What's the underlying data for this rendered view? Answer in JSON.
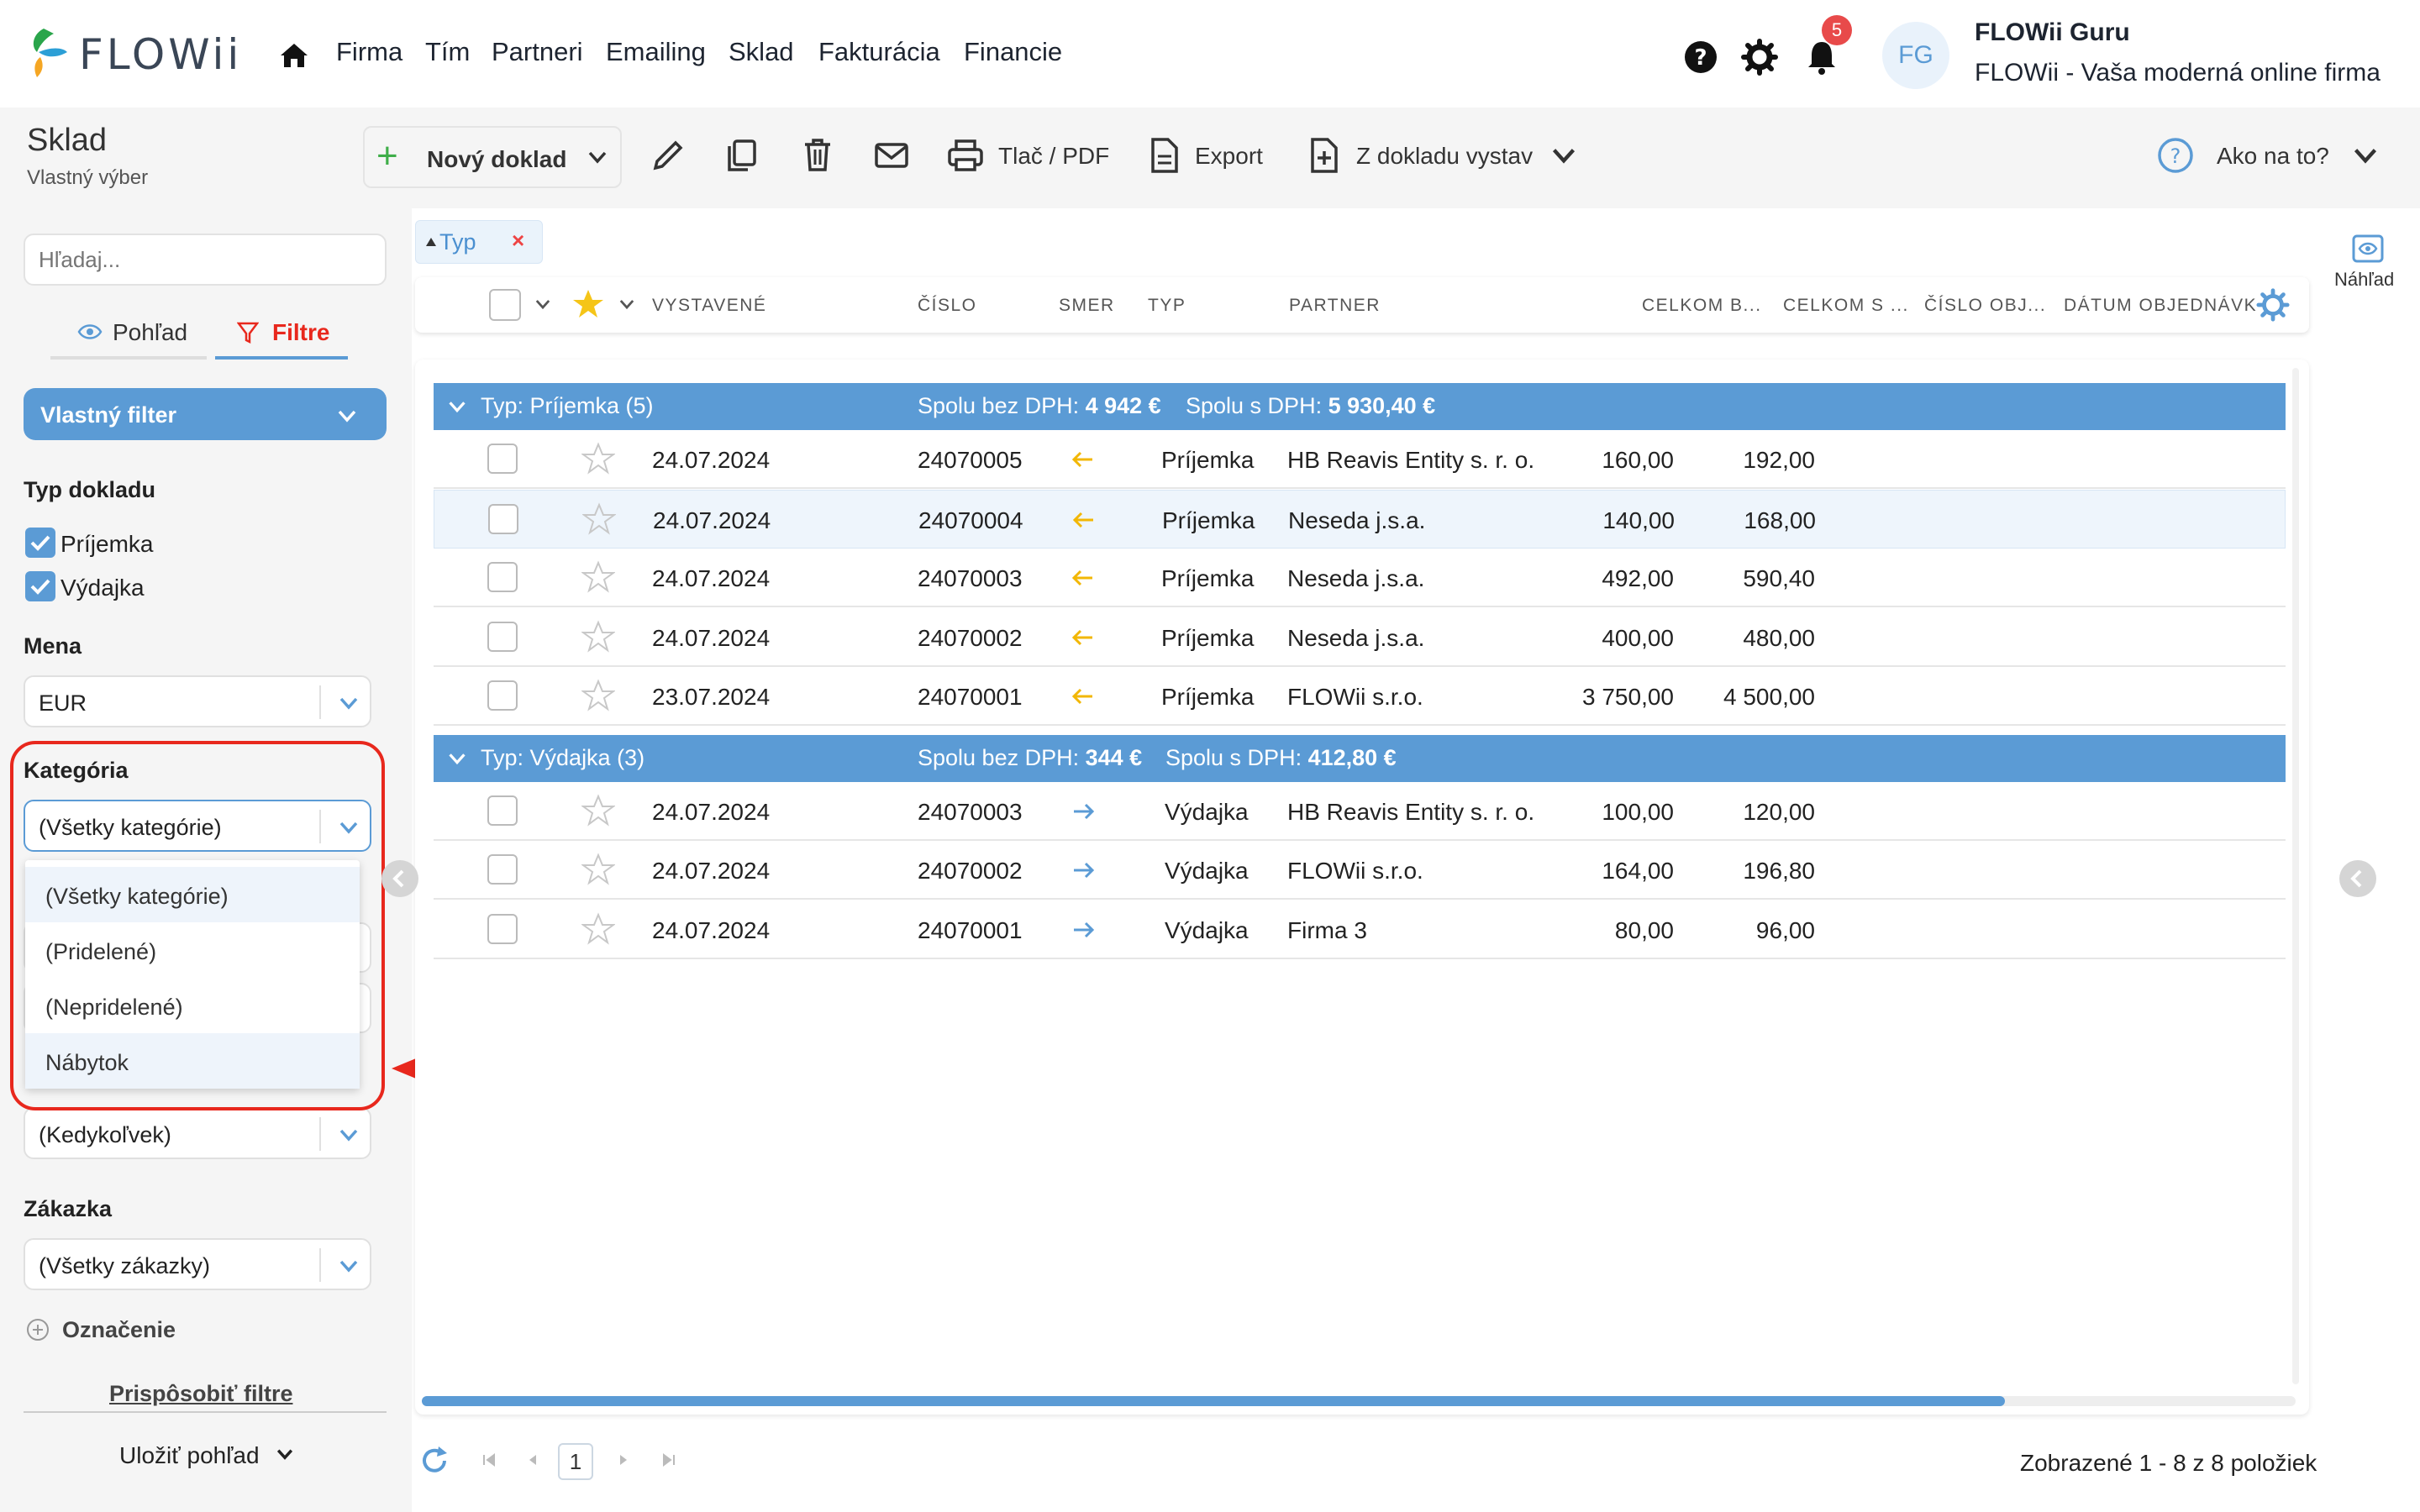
{
  "app": {
    "logo_text": "FLOWii"
  },
  "nav": {
    "links": [
      "Firma",
      "Tím",
      "Partneri",
      "Emailing",
      "Sklad",
      "Fakturácia",
      "Financie"
    ],
    "notification_count": "5",
    "user_initials": "FG",
    "user_name": "FLOWii Guru",
    "user_company": "FLOWii - Vaša moderná online firma"
  },
  "toolbar": {
    "title": "Sklad",
    "subtitle": "Vlastný výber",
    "new_doc_label": "Nový doklad",
    "print_label": "Tlač / PDF",
    "export_label": "Export",
    "from_doc_label": "Z dokladu vystav",
    "help_label": "Ako na to?"
  },
  "sidebar": {
    "search_placeholder": "Hľadaj...",
    "tab_view": "Pohľad",
    "tab_filters": "Filtre",
    "custom_filter": "Vlastný filter",
    "doc_type_label": "Typ dokladu",
    "doc_types": [
      "Príjemka",
      "Výdajka"
    ],
    "currency_label": "Mena",
    "currency_value": "EUR",
    "category_label": "Kategória",
    "category_value": "(Všetky kategórie)",
    "category_options": [
      "(Všetky kategórie)",
      "(Pridelené)",
      "(Nepridelené)",
      "Nábytok"
    ],
    "date_value": "(Kedykoľvek)",
    "order_label": "Zákazka",
    "order_value": "(Všetky zákazky)",
    "tag_label": "Označenie",
    "customize_label": "Prispôsobiť filtre",
    "save_view_label": "Uložiť pohľad"
  },
  "filter_chip": {
    "label": "Typ",
    "remove": "×"
  },
  "columns": [
    "VYSTAVENÉ",
    "ČÍSLO",
    "SMER",
    "TYP",
    "PARTNER",
    "CELKOM B...",
    "CELKOM S ...",
    "ČÍSLO OBJ...",
    "DÁTUM OBJEDNÁVK"
  ],
  "groups": [
    {
      "title": "Typ: Príjemka (5)",
      "sum_wo_label": "Spolu bez DPH:",
      "sum_wo": "4 942 €",
      "sum_w_label": "Spolu s DPH:",
      "sum_w": "5 930,40 €",
      "rows": [
        {
          "date": "24.07.2024",
          "number": "24070005",
          "dir": "in",
          "type": "Príjemka",
          "partner": "HB Reavis Entity s. r. o.",
          "total_wo": "160,00",
          "total_w": "192,00"
        },
        {
          "date": "24.07.2024",
          "number": "24070004",
          "dir": "in",
          "type": "Príjemka",
          "partner": "Neseda j.s.a.",
          "total_wo": "140,00",
          "total_w": "168,00"
        },
        {
          "date": "24.07.2024",
          "number": "24070003",
          "dir": "in",
          "type": "Príjemka",
          "partner": "Neseda j.s.a.",
          "total_wo": "492,00",
          "total_w": "590,40"
        },
        {
          "date": "24.07.2024",
          "number": "24070002",
          "dir": "in",
          "type": "Príjemka",
          "partner": "Neseda j.s.a.",
          "total_wo": "400,00",
          "total_w": "480,00"
        },
        {
          "date": "23.07.2024",
          "number": "24070001",
          "dir": "in",
          "type": "Príjemka",
          "partner": "FLOWii s.r.o.",
          "total_wo": "3 750,00",
          "total_w": "4 500,00"
        }
      ]
    },
    {
      "title": "Typ: Výdajka (3)",
      "sum_wo_label": "Spolu bez DPH:",
      "sum_wo": "344 €",
      "sum_w_label": "Spolu s DPH:",
      "sum_w": "412,80 €",
      "rows": [
        {
          "date": "24.07.2024",
          "number": "24070003",
          "dir": "out",
          "type": "Výdajka",
          "partner": "HB Reavis Entity s. r. o.",
          "total_wo": "100,00",
          "total_w": "120,00"
        },
        {
          "date": "24.07.2024",
          "number": "24070002",
          "dir": "out",
          "type": "Výdajka",
          "partner": "FLOWii s.r.o.",
          "total_wo": "164,00",
          "total_w": "196,80"
        },
        {
          "date": "24.07.2024",
          "number": "24070001",
          "dir": "out",
          "type": "Výdajka",
          "partner": "Firma 3",
          "total_wo": "80,00",
          "total_w": "96,00"
        }
      ]
    }
  ],
  "pager": {
    "current_page": "1",
    "info": "Zobrazené 1 - 8 z 8 položiek"
  },
  "preview_label": "Náhľad",
  "colors": {
    "accent": "#5b9bd5",
    "danger": "#e8281d",
    "in_arrow": "#f2b705",
    "out_arrow": "#5b9bd5"
  }
}
